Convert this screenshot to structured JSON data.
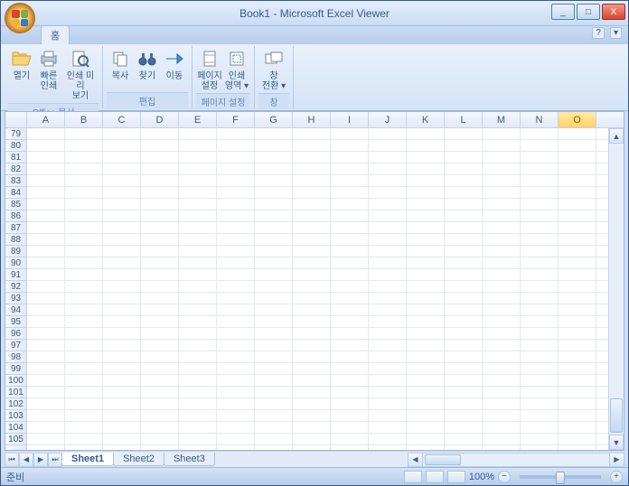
{
  "window": {
    "title": "Book1 - Microsoft Excel Viewer",
    "minimize": "_",
    "maximize": "□",
    "close": "X",
    "help": "?",
    "restore_down": "▾"
  },
  "tab": {
    "home": "홈"
  },
  "ribbon": {
    "open": "열기",
    "quick_print": "빠른",
    "quick_print2": "인쇄",
    "preview": "인쇄 미리",
    "preview2": "보기",
    "group_office": "Office 문서",
    "copy": "복사",
    "find": "찾기",
    "goto": "이동",
    "group_edit": "편집",
    "page_setup": "페이지",
    "page_setup2": "설정",
    "print_area": "인쇄",
    "print_area2": "영역 ▾",
    "group_page": "페이지 설정",
    "windows": "창",
    "windows2": "전환 ▾",
    "group_win": "창"
  },
  "columns": [
    "A",
    "B",
    "C",
    "D",
    "E",
    "F",
    "G",
    "H",
    "I",
    "J",
    "K",
    "L",
    "M",
    "N",
    "O"
  ],
  "selected_column_index": 14,
  "rows": [
    79,
    80,
    81,
    82,
    83,
    84,
    85,
    86,
    87,
    88,
    89,
    90,
    91,
    92,
    93,
    94,
    95,
    96,
    97,
    98,
    99,
    100,
    101,
    102,
    103,
    104,
    105
  ],
  "sheets": {
    "s1": "Sheet1",
    "s2": "Sheet2",
    "s3": "Sheet3"
  },
  "nav": {
    "first": "⏮",
    "prev": "◀",
    "next": "▶",
    "last": "⏭"
  },
  "status": {
    "ready": "준비",
    "zoom": "100%",
    "minus": "−",
    "plus": "+"
  },
  "scroll": {
    "up": "▲",
    "down": "▼",
    "left": "◀",
    "right": "▶"
  }
}
